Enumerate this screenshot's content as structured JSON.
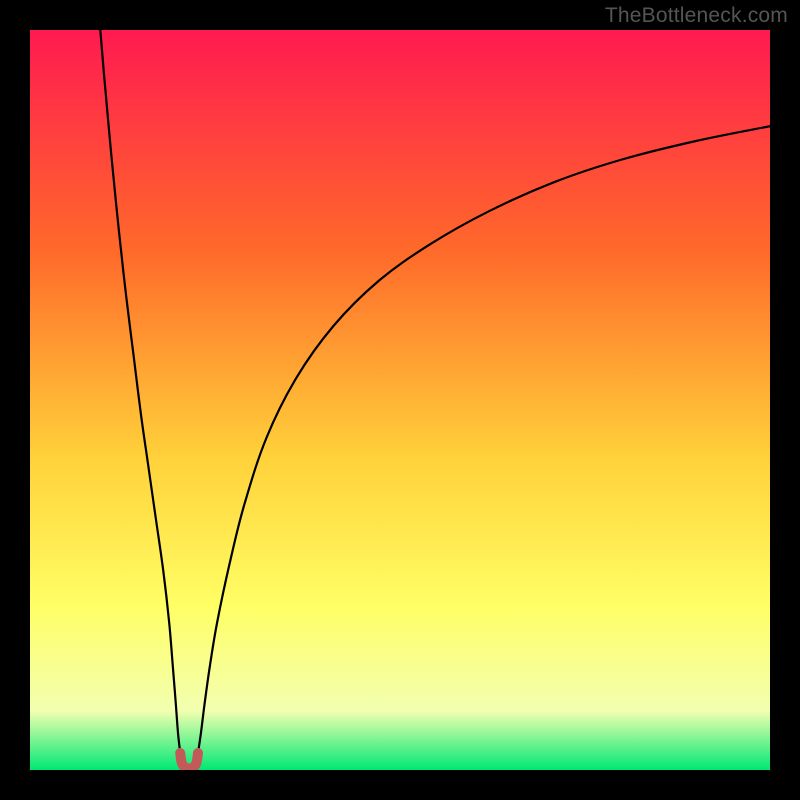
{
  "watermark": "TheBottleneck.com",
  "colors": {
    "frame": "#000000",
    "grad_top": "#ff1a50",
    "grad_mid1": "#ff6a2a",
    "grad_mid2": "#ffd23a",
    "grad_mid3": "#ffff66",
    "grad_mid4": "#f2ffb0",
    "grad_bottom": "#00e874",
    "curve": "#000000",
    "marker": "#c35a5a"
  },
  "chart_data": {
    "type": "line",
    "title": "",
    "xlabel": "",
    "ylabel": "",
    "xlim": [
      0,
      100
    ],
    "ylim": [
      0,
      100
    ],
    "series": [
      {
        "name": "left-branch",
        "x": [
          9.5,
          10,
          11,
          12,
          13,
          14,
          15,
          16,
          17,
          18,
          18.8,
          19.3,
          19.7,
          20.0,
          20.3
        ],
        "y": [
          100,
          94,
          83,
          73,
          64,
          56,
          48,
          41,
          34,
          27,
          20,
          14,
          9,
          5,
          2.3
        ]
      },
      {
        "name": "right-branch",
        "x": [
          22.7,
          23.1,
          23.6,
          24.3,
          25.3,
          27,
          29,
          32,
          36,
          41,
          47,
          54,
          62,
          71,
          80,
          90,
          100
        ],
        "y": [
          2.3,
          5,
          9,
          14,
          20,
          28,
          36,
          45,
          53,
          60,
          66,
          71,
          75.5,
          79.5,
          82.5,
          85,
          87
        ]
      },
      {
        "name": "optimal-marker-u",
        "x": [
          20.3,
          20.5,
          20.9,
          21.5,
          22.1,
          22.5,
          22.7
        ],
        "y": [
          2.3,
          1.0,
          0.4,
          0.2,
          0.4,
          1.0,
          2.3
        ]
      }
    ],
    "annotations": []
  }
}
